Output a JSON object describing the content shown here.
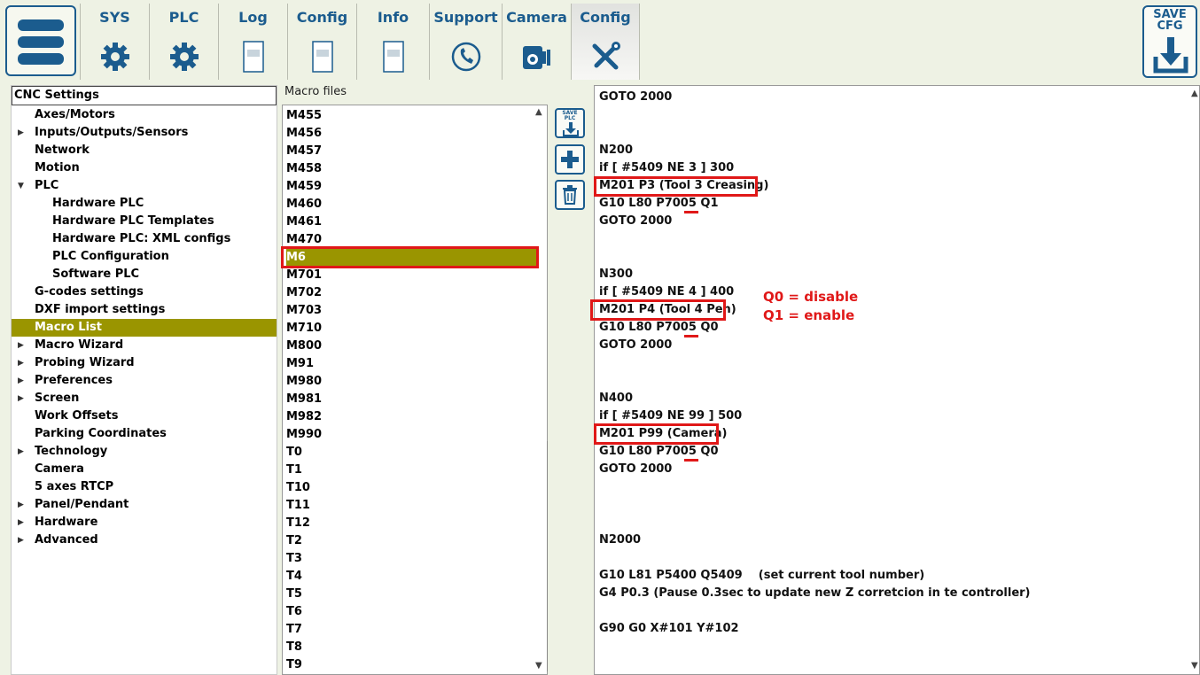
{
  "toolbar": {
    "tabs": [
      {
        "label": "SYS",
        "icon": "gear-icon"
      },
      {
        "label": "PLC",
        "icon": "gear-icon"
      },
      {
        "label": "Log",
        "icon": "document-icon"
      },
      {
        "label": "Config",
        "icon": "document-icon"
      },
      {
        "label": "Info",
        "icon": "document-icon"
      },
      {
        "label": "Support",
        "icon": "phone-icon"
      },
      {
        "label": "Camera",
        "icon": "camera-icon"
      },
      {
        "label": "Config",
        "icon": "tools-icon"
      }
    ],
    "save_cfg_label_1": "SAVE",
    "save_cfg_label_2": "CFG"
  },
  "tree": {
    "header": "CNC Settings",
    "items": [
      {
        "label": "Axes/Motors",
        "arrow": ""
      },
      {
        "label": "Inputs/Outputs/Sensors",
        "arrow": "▶"
      },
      {
        "label": "Network",
        "arrow": ""
      },
      {
        "label": "Motion",
        "arrow": ""
      },
      {
        "label": "PLC",
        "arrow": "▼"
      },
      {
        "label": "Hardware PLC",
        "arrow": ""
      },
      {
        "label": "Hardware PLC Templates",
        "arrow": ""
      },
      {
        "label": "Hardware PLC: XML configs",
        "arrow": ""
      },
      {
        "label": "PLC Configuration",
        "arrow": ""
      },
      {
        "label": "Software PLC",
        "arrow": ""
      },
      {
        "label": "G-codes settings",
        "arrow": ""
      },
      {
        "label": "DXF import settings",
        "arrow": ""
      },
      {
        "label": "Macro List",
        "arrow": ""
      },
      {
        "label": "Macro Wizard",
        "arrow": "▶"
      },
      {
        "label": "Probing Wizard",
        "arrow": "▶"
      },
      {
        "label": "Preferences",
        "arrow": "▶"
      },
      {
        "label": "Screen",
        "arrow": "▶"
      },
      {
        "label": "Work Offsets",
        "arrow": ""
      },
      {
        "label": "Parking Coordinates",
        "arrow": ""
      },
      {
        "label": "Technology",
        "arrow": "▶"
      },
      {
        "label": "Camera",
        "arrow": ""
      },
      {
        "label": "5 axes RTCP",
        "arrow": ""
      },
      {
        "label": "Panel/Pendant",
        "arrow": "▶"
      },
      {
        "label": "Hardware",
        "arrow": "▶"
      },
      {
        "label": "Advanced",
        "arrow": "▶"
      }
    ],
    "selected": "Macro List"
  },
  "macro_files": {
    "label": "Macro files",
    "items": [
      "M455",
      "M456",
      "M457",
      "M458",
      "M459",
      "M460",
      "M461",
      "M470",
      "M6",
      "M701",
      "M702",
      "M703",
      "M710",
      "M800",
      "M91",
      "M980",
      "M981",
      "M982",
      "M990",
      "T0",
      "T1",
      "T10",
      "T11",
      "T12",
      "T2",
      "T3",
      "T4",
      "T5",
      "T6",
      "T7",
      "T8",
      "T9"
    ],
    "selected": "M6"
  },
  "side_buttons": {
    "save_plc_1": "SAVE",
    "save_plc_2": "PLC",
    "add": "+"
  },
  "code_lines": [
    "GOTO 2000",
    "N200",
    "if [ #5409 NE 3 ] 300",
    "M201 P3 (Tool 3 Creasing)",
    "G10 L80 P7005 Q1",
    "GOTO 2000",
    "N300",
    "if [ #5409 NE 4 ] 400",
    "M201 P4 (Tool 4 Pen)",
    "G10 L80 P7005 Q0",
    "GOTO 2000",
    "N400",
    "if [ #5409 NE 99 ] 500",
    "M201 P99 (Camera)",
    "G10 L80 P7005 Q0",
    "GOTO 2000",
    "N2000",
    "G10 L81 P5400 Q5409    (set current tool number)",
    "G4 P0.3 (Pause 0.3sec to update new Z corretcion in te controller)",
    "G90 G0 X#101 Y#102"
  ],
  "annotations": {
    "q0": "Q0 = disable",
    "q1": "Q1 = enable"
  },
  "colors": {
    "accent": "#1b5c8e",
    "selection": "#9a9500",
    "highlight": "#e01818"
  }
}
